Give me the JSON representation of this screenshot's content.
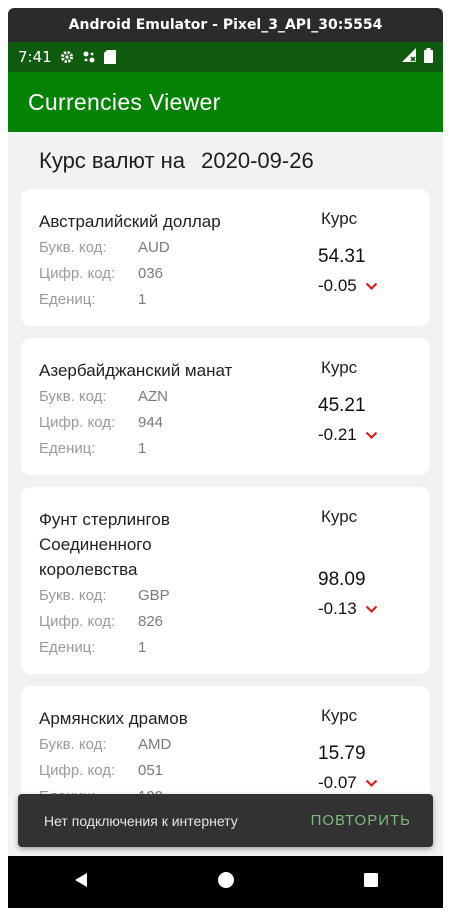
{
  "emulator": {
    "title": "Android Emulator - Pixel_3_API_30:5554"
  },
  "status_bar": {
    "time": "7:41",
    "icons_left": [
      "gear-icon",
      "fan-icon",
      "sd-card-icon"
    ],
    "icons_right": [
      "signal-icon",
      "battery-icon"
    ]
  },
  "app_bar": {
    "title": "Currencies Viewer",
    "color": "#038203"
  },
  "header": {
    "label": "Курс валют на",
    "date": "2020-09-26"
  },
  "labels": {
    "char_code": "Букв. код:",
    "num_code": "Цифр. код:",
    "nominal": "Едениц:",
    "rate": "Курс"
  },
  "currencies": [
    {
      "name": "Австралийский доллар",
      "char_code": "AUD",
      "num_code": "036",
      "nominal": "1",
      "rate": "54.31",
      "change": "-0.05",
      "trend": "down"
    },
    {
      "name": "Азербайджанский манат",
      "char_code": "AZN",
      "num_code": "944",
      "nominal": "1",
      "rate": "45.21",
      "change": "-0.21",
      "trend": "down"
    },
    {
      "name": "Фунт стерлингов Соединенного королевства",
      "char_code": "GBP",
      "num_code": "826",
      "nominal": "1",
      "rate": "98.09",
      "change": "-0.13",
      "trend": "down"
    },
    {
      "name": "Армянских драмов",
      "char_code": "AMD",
      "num_code": "051",
      "nominal": "100",
      "rate": "15.79",
      "change": "-0.07",
      "trend": "down"
    }
  ],
  "snackbar": {
    "message": "Нет подключения к интернету",
    "action": "ПОВТОРИТЬ"
  },
  "nav_bar": {
    "buttons": [
      "back-icon",
      "home-icon",
      "recents-icon"
    ]
  },
  "colors": {
    "trend_down": "#e0201f",
    "snackbar_action": "#7dba7d"
  }
}
